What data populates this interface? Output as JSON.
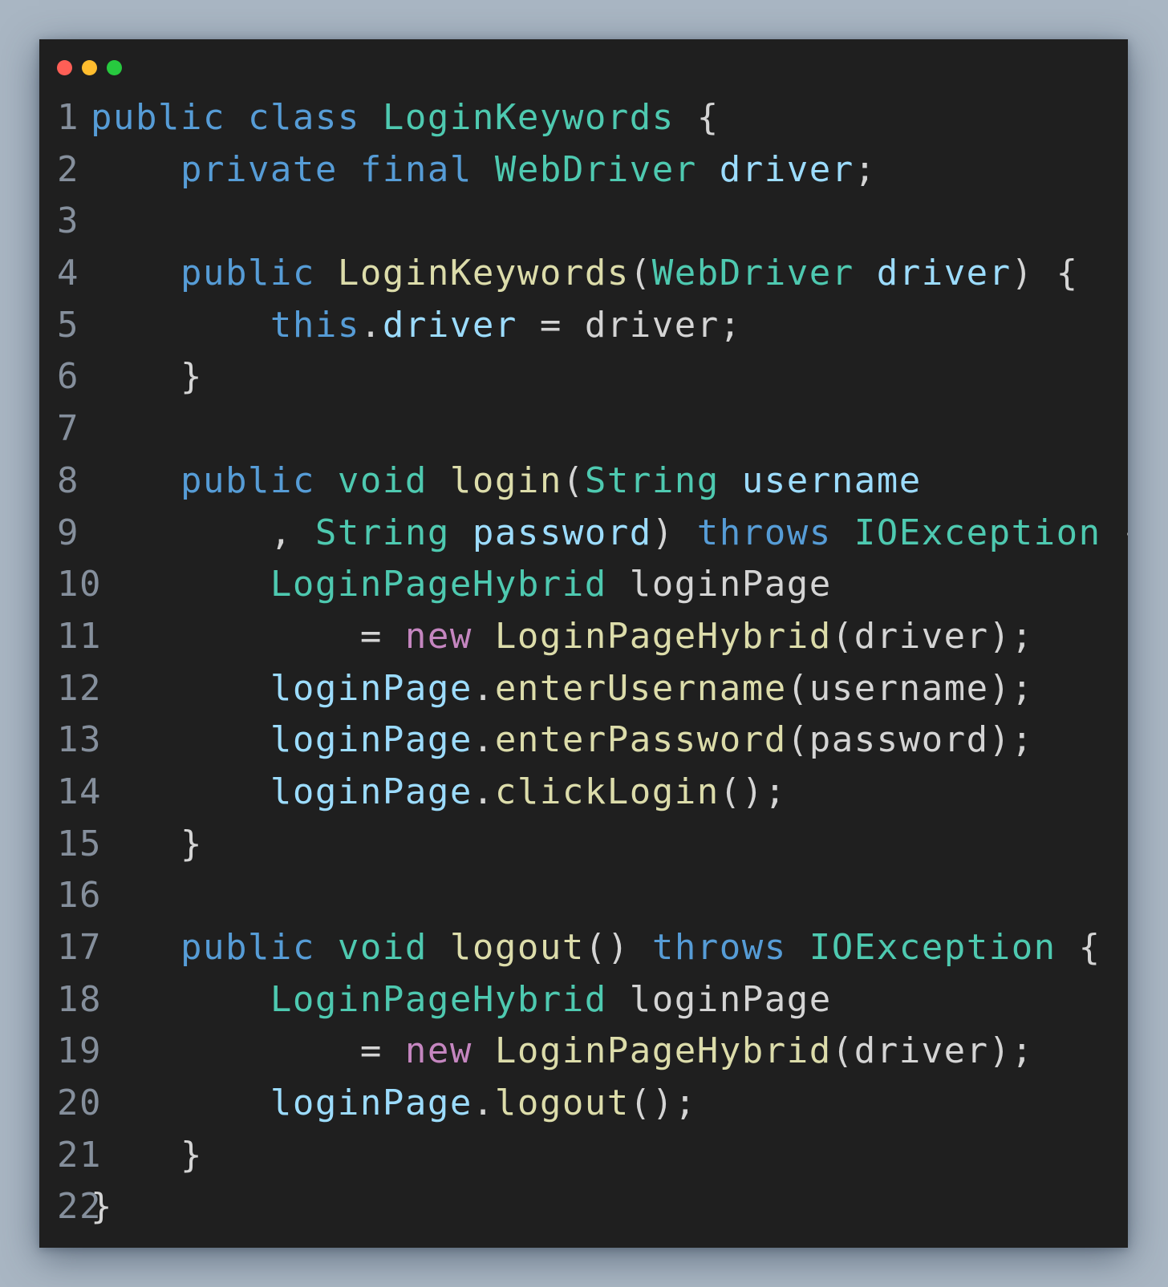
{
  "window": {
    "traffic_lights": [
      {
        "name": "close",
        "color": "#ff5f56"
      },
      {
        "name": "minimize",
        "color": "#ffbd2e"
      },
      {
        "name": "zoom",
        "color": "#27c93f"
      }
    ]
  },
  "code": {
    "lines": [
      {
        "n": "1",
        "indent": 0,
        "tokens": [
          [
            "kw",
            "public"
          ],
          [
            "p",
            " "
          ],
          [
            "kw",
            "class"
          ],
          [
            "p",
            " "
          ],
          [
            "ty",
            "LoginKeywords"
          ],
          [
            "p",
            " {"
          ]
        ]
      },
      {
        "n": "2",
        "indent": 4,
        "tokens": [
          [
            "kw",
            "private"
          ],
          [
            "p",
            " "
          ],
          [
            "kw",
            "final"
          ],
          [
            "p",
            " "
          ],
          [
            "ty",
            "WebDriver"
          ],
          [
            "p",
            " "
          ],
          [
            "var",
            "driver"
          ],
          [
            "p",
            ";"
          ]
        ]
      },
      {
        "n": "3",
        "indent": 0,
        "tokens": []
      },
      {
        "n": "4",
        "indent": 4,
        "tokens": [
          [
            "kw",
            "public"
          ],
          [
            "p",
            " "
          ],
          [
            "fn",
            "LoginKeywords"
          ],
          [
            "p",
            "("
          ],
          [
            "ty",
            "WebDriver"
          ],
          [
            "p",
            " "
          ],
          [
            "var",
            "driver"
          ],
          [
            "p",
            ") {"
          ]
        ]
      },
      {
        "n": "5",
        "indent": 8,
        "tokens": [
          [
            "kw",
            "this"
          ],
          [
            "p",
            "."
          ],
          [
            "var",
            "driver"
          ],
          [
            "p",
            " = driver;"
          ]
        ]
      },
      {
        "n": "6",
        "indent": 4,
        "tokens": [
          [
            "p",
            "}"
          ]
        ]
      },
      {
        "n": "7",
        "indent": 0,
        "tokens": []
      },
      {
        "n": "8",
        "indent": 4,
        "tokens": [
          [
            "kw",
            "public"
          ],
          [
            "p",
            " "
          ],
          [
            "ty",
            "void"
          ],
          [
            "p",
            " "
          ],
          [
            "fn",
            "login"
          ],
          [
            "p",
            "("
          ],
          [
            "ty",
            "String"
          ],
          [
            "p",
            " "
          ],
          [
            "var",
            "username"
          ]
        ]
      },
      {
        "n": "9",
        "indent": 8,
        "tokens": [
          [
            "p",
            ", "
          ],
          [
            "ty",
            "String"
          ],
          [
            "p",
            " "
          ],
          [
            "var",
            "password"
          ],
          [
            "p",
            ") "
          ],
          [
            "kw",
            "throws"
          ],
          [
            "p",
            " "
          ],
          [
            "ty",
            "IOException"
          ],
          [
            "p",
            " {"
          ]
        ]
      },
      {
        "n": "10",
        "indent": 8,
        "tokens": [
          [
            "ty",
            "LoginPageHybrid"
          ],
          [
            "p",
            " loginPage"
          ]
        ]
      },
      {
        "n": "11",
        "indent": 12,
        "tokens": [
          [
            "p",
            "= "
          ],
          [
            "new",
            "new"
          ],
          [
            "p",
            " "
          ],
          [
            "fn",
            "LoginPageHybrid"
          ],
          [
            "p",
            "(driver);"
          ]
        ]
      },
      {
        "n": "12",
        "indent": 8,
        "tokens": [
          [
            "var",
            "loginPage"
          ],
          [
            "p",
            "."
          ],
          [
            "fn",
            "enterUsername"
          ],
          [
            "p",
            "(username);"
          ]
        ]
      },
      {
        "n": "13",
        "indent": 8,
        "tokens": [
          [
            "var",
            "loginPage"
          ],
          [
            "p",
            "."
          ],
          [
            "fn",
            "enterPassword"
          ],
          [
            "p",
            "(password);"
          ]
        ]
      },
      {
        "n": "14",
        "indent": 8,
        "tokens": [
          [
            "var",
            "loginPage"
          ],
          [
            "p",
            "."
          ],
          [
            "fn",
            "clickLogin"
          ],
          [
            "p",
            "();"
          ]
        ]
      },
      {
        "n": "15",
        "indent": 4,
        "tokens": [
          [
            "p",
            "}"
          ]
        ]
      },
      {
        "n": "16",
        "indent": 0,
        "tokens": []
      },
      {
        "n": "17",
        "indent": 4,
        "tokens": [
          [
            "kw",
            "public"
          ],
          [
            "p",
            " "
          ],
          [
            "ty",
            "void"
          ],
          [
            "p",
            " "
          ],
          [
            "fn",
            "logout"
          ],
          [
            "p",
            "() "
          ],
          [
            "kw",
            "throws"
          ],
          [
            "p",
            " "
          ],
          [
            "ty",
            "IOException"
          ],
          [
            "p",
            " {"
          ]
        ]
      },
      {
        "n": "18",
        "indent": 8,
        "tokens": [
          [
            "ty",
            "LoginPageHybrid"
          ],
          [
            "p",
            " loginPage"
          ]
        ]
      },
      {
        "n": "19",
        "indent": 12,
        "tokens": [
          [
            "p",
            "= "
          ],
          [
            "new",
            "new"
          ],
          [
            "p",
            " "
          ],
          [
            "fn",
            "LoginPageHybrid"
          ],
          [
            "p",
            "(driver);"
          ]
        ]
      },
      {
        "n": "20",
        "indent": 8,
        "tokens": [
          [
            "var",
            "loginPage"
          ],
          [
            "p",
            "."
          ],
          [
            "fn",
            "logout"
          ],
          [
            "p",
            "();"
          ]
        ]
      },
      {
        "n": "21",
        "indent": 4,
        "tokens": [
          [
            "p",
            "}"
          ]
        ]
      },
      {
        "n": "22",
        "indent": 0,
        "tokens": [
          [
            "p",
            "}"
          ]
        ]
      }
    ]
  }
}
